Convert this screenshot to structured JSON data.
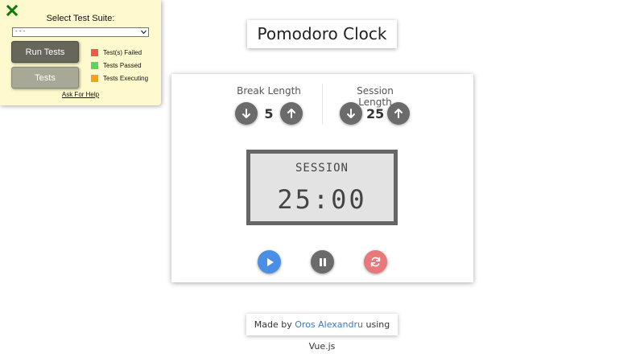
{
  "test_panel": {
    "title": "Select Test Suite:",
    "selected_suite": "- - -",
    "run_label": "Run Tests",
    "tests_label": "Tests",
    "legend": [
      {
        "label": "Test(s) Failed",
        "color": "#f05a45"
      },
      {
        "label": "Tests Passed",
        "color": "#5fd35f"
      },
      {
        "label": "Tests Executing",
        "color": "#f5a319"
      }
    ],
    "help_label": "Ask For Help",
    "close_icon": "close-x-icon",
    "close_color": "#0a7a0a"
  },
  "title": "Pomodoro Clock",
  "break": {
    "label": "Break Length",
    "value": "5"
  },
  "session": {
    "label": "Session Length",
    "value": "25"
  },
  "timer": {
    "label": "SESSION",
    "time": "25:00"
  },
  "controls": {
    "play": {
      "icon": "play-icon",
      "color": "#4a8ee6"
    },
    "pause": {
      "icon": "pause-icon",
      "color": "#6b6b6b"
    },
    "reset": {
      "icon": "refresh-icon",
      "color": "#e8787a"
    }
  },
  "footer": {
    "prefix": "Made by",
    "author": "Oros Alexandru",
    "suffix": "using Vue.js"
  }
}
